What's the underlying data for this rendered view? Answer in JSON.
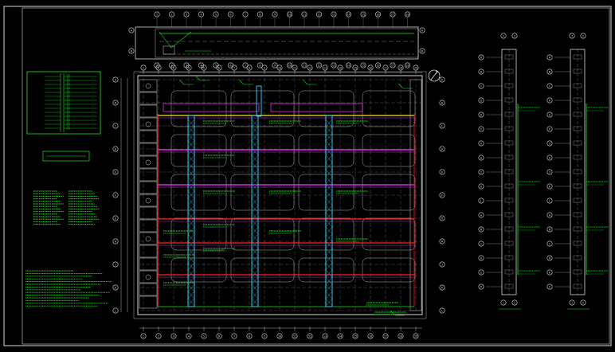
{
  "drawing": {
    "background": "#000000",
    "frame_color": "#d8d8d8",
    "colors": {
      "wall": "#d8d8d8",
      "grid": "#b0b0b0",
      "green": "#22e022",
      "red": "#ff2020",
      "magenta": "#ff30ff",
      "cyan": "#30d8ff",
      "yellow": "#ffe020"
    },
    "axis_numbers_top": [
      "1",
      "2",
      "3",
      "4",
      "5",
      "6",
      "7",
      "8",
      "9",
      "10",
      "11",
      "12",
      "13",
      "14",
      "15",
      "16",
      "17",
      "18",
      "19"
    ],
    "axis_letters_left": [
      "A",
      "B",
      "C",
      "D",
      "E",
      "F",
      "G",
      "H",
      "J",
      "K",
      "L"
    ],
    "compass_icon": "north-arrow-icon"
  }
}
